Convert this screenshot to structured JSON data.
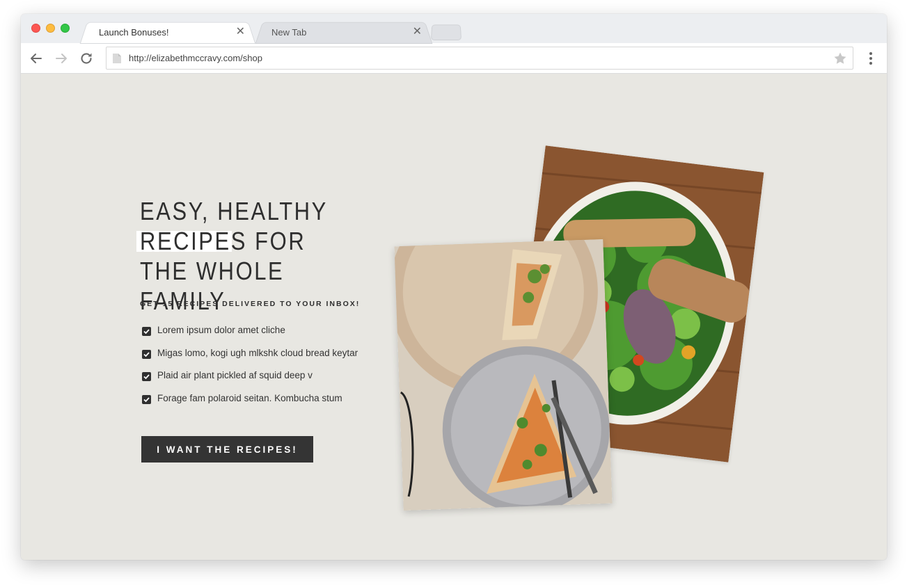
{
  "browser": {
    "tabs": [
      {
        "label": "Launch Bonuses!",
        "active": true
      },
      {
        "label": "New Tab",
        "active": false
      }
    ],
    "close_glyph": "✕",
    "url": "http://elizabethmccravy.com/shop",
    "icons": [
      "back-arrow-icon",
      "forward-arrow-icon",
      "reload-icon",
      "page-icon",
      "star-icon",
      "menu-dots-icon"
    ]
  },
  "hero": {
    "headline": "EASY, HEALTHY RECIPES FOR THE WHOLE FAMILY",
    "subhead": "GET 15 RECIPES DELIVERED TO YOUR INBOX!",
    "checklist": [
      "Lorem ipsum dolor amet cliche",
      "Migas lomo, kogi ugh mlkshk cloud bread keytar",
      "Plaid air plant pickled af squid deep v",
      "Forage fam polaroid seitan. Kombucha stum"
    ],
    "cta_label": "I WANT THE RECIPES!"
  },
  "colors": {
    "page_background": "#e8e7e2",
    "text": "#2e2e2e",
    "button": "#343434",
    "button_text": "#ffffff"
  }
}
